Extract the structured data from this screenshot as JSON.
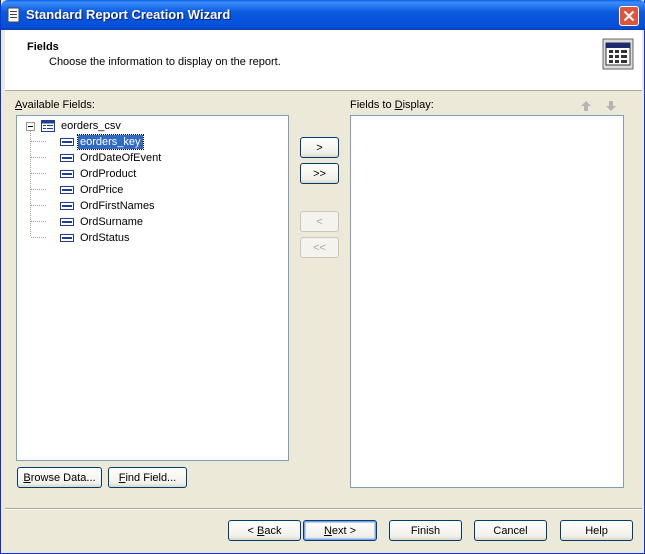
{
  "window": {
    "title": "Standard Report Creation Wizard"
  },
  "header": {
    "title": "Fields",
    "subtitle": "Choose the information to display on the report."
  },
  "available": {
    "label_first": "A",
    "label_rest": "vailable Fields:",
    "root": "eorders_csv",
    "items": [
      "eorders_key",
      "OrdDateOfEvent",
      "OrdProduct",
      "OrdPrice",
      "OrdFirstNames",
      "OrdSurname",
      "OrdStatus"
    ],
    "selected_index": 0
  },
  "display": {
    "label_pre": "Fields to ",
    "label_u": "D",
    "label_rest": "isplay:"
  },
  "transfer": {
    "add": ">",
    "add_all": ">>",
    "remove": "<",
    "remove_all": "<<"
  },
  "buttons": {
    "browse_u": "B",
    "browse_rest": "rowse Data...",
    "find_u": "F",
    "find_rest": "ind Field...",
    "back_pre": "< ",
    "back_u": "B",
    "back_rest": "ack",
    "next_u": "N",
    "next_rest": "ext >",
    "finish": "Finish",
    "cancel": "Cancel",
    "help": "Help"
  }
}
